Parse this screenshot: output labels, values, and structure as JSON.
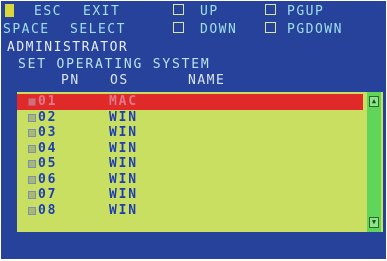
{
  "help": {
    "esc_key": "ESC",
    "exit_label": "EXIT",
    "up_label": "UP",
    "pgup_label": "PGUP",
    "space_key": "SPACE",
    "select_label": "SELECT",
    "down_label": "DOWN",
    "pgdown_label": "PGDOWN"
  },
  "title": "ADMINISTRATOR",
  "subtitle": "SET OPERATING SYSTEM",
  "columns": {
    "pn": "PN",
    "os": "OS",
    "name": "NAME"
  },
  "rows": [
    {
      "pn": "01",
      "os": "MAC",
      "selected": true
    },
    {
      "pn": "02",
      "os": "WIN"
    },
    {
      "pn": "03",
      "os": "WIN"
    },
    {
      "pn": "04",
      "os": "WIN"
    },
    {
      "pn": "05",
      "os": "WIN"
    },
    {
      "pn": "06",
      "os": "WIN"
    },
    {
      "pn": "07",
      "os": "WIN"
    },
    {
      "pn": "08",
      "os": "WIN"
    }
  ],
  "colors": {
    "background": "#26429a",
    "list_background": "#c9df62",
    "selected_row": "#e02a2a",
    "scrollbar": "#5fd65a"
  },
  "icons": {
    "up_key": "up-arrow-key-icon",
    "down_key": "down-arrow-key-icon",
    "pgup_key": "page-up-key-icon",
    "pgdown_key": "page-down-key-icon"
  }
}
